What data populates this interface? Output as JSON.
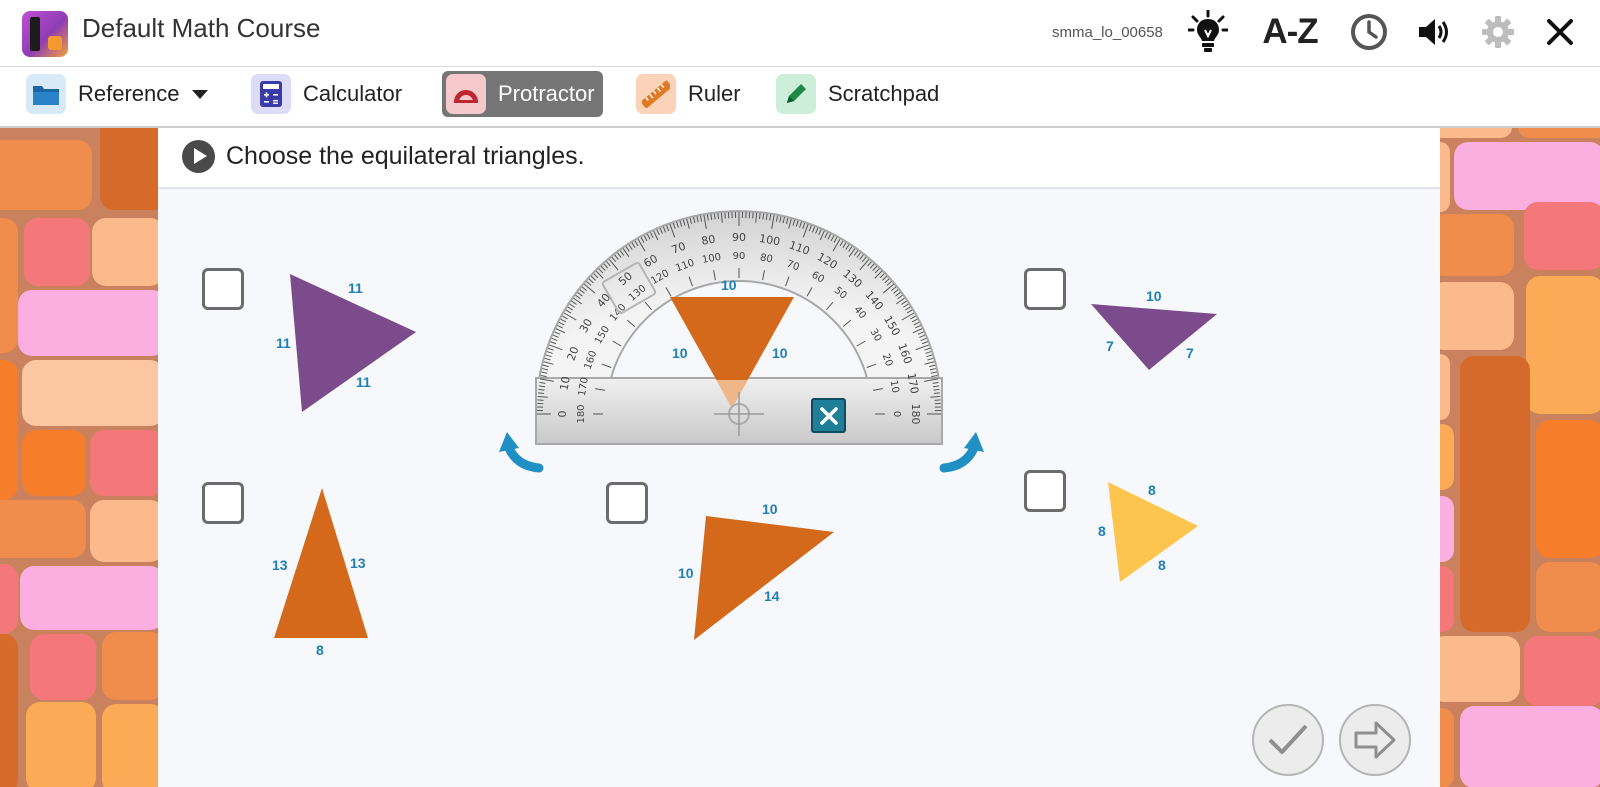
{
  "header": {
    "course_title": "Default Math Course",
    "course_code": "smma_lo_00658",
    "glossary_label": "A-Z",
    "icons": [
      "lightbulb-icon",
      "glossary-icon",
      "timer-icon",
      "speaker-icon",
      "gear-icon",
      "close-icon"
    ]
  },
  "toolbar": {
    "reference_label": "Reference",
    "calculator_label": "Calculator",
    "protractor_label": "Protractor",
    "ruler_label": "Ruler",
    "scratchpad_label": "Scratchpad",
    "active_tool": "Protractor"
  },
  "question": {
    "text": "Choose the equilateral triangles."
  },
  "choices": [
    {
      "id": "a",
      "checked": false,
      "color": "#7b4b8c",
      "sides": [
        "11",
        "11",
        "11"
      ]
    },
    {
      "id": "b",
      "checked": false,
      "color": "#7b4b8c",
      "sides": [
        "10",
        "7",
        "7"
      ]
    },
    {
      "id": "c",
      "checked": false,
      "color": "#d4691b",
      "sides": [
        "13",
        "13",
        "8"
      ]
    },
    {
      "id": "d",
      "checked": false,
      "color": "#d4691b",
      "sides": [
        "10",
        "10",
        "14"
      ]
    },
    {
      "id": "e",
      "checked": false,
      "color": "#fdc54e",
      "sides": [
        "8",
        "8",
        "8"
      ]
    }
  ],
  "protractor_overlay_triangle": {
    "color": "#d4691b",
    "sides": [
      "10",
      "10",
      "10"
    ]
  },
  "protractor": {
    "outer_scale": [
      "0",
      "10",
      "20",
      "30",
      "40",
      "50",
      "60",
      "70",
      "80",
      "90",
      "100",
      "110",
      "120",
      "130",
      "140",
      "150",
      "160",
      "170",
      "180"
    ],
    "inner_scale": [
      "180",
      "170",
      "160",
      "150",
      "140",
      "130",
      "120",
      "110",
      "100",
      "90",
      "80",
      "70",
      "60",
      "50",
      "40",
      "30",
      "20",
      "10",
      "0"
    ]
  },
  "colors": {
    "accent": "#1f7fb3",
    "protractor_active": "#757575",
    "purple": "#7b4b8c",
    "orange": "#d4691b",
    "yellow": "#fdc54e"
  }
}
